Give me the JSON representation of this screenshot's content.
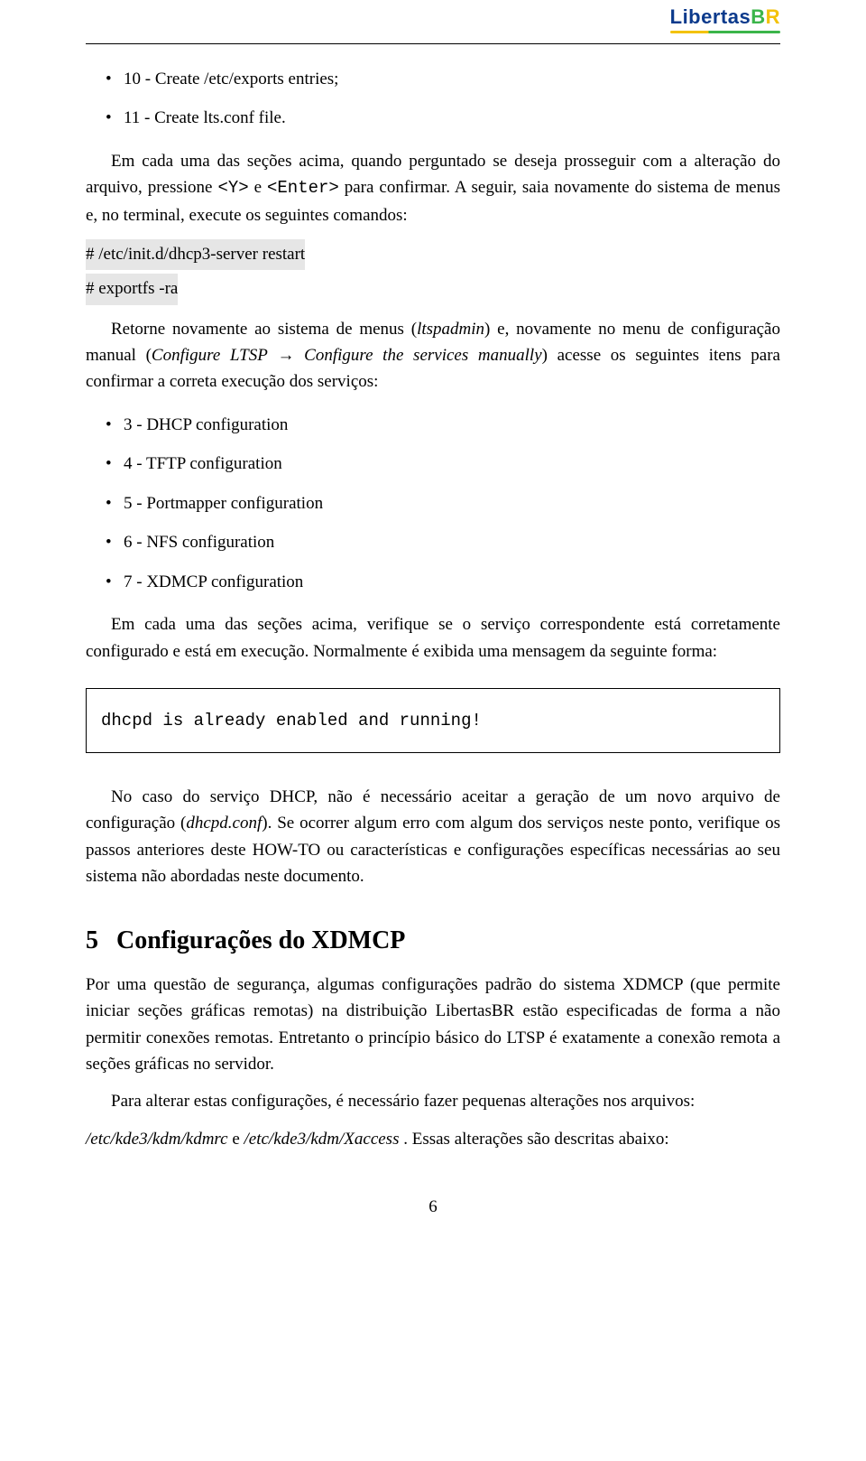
{
  "logo": {
    "text_part1": "Libertas",
    "text_part2": "B",
    "text_part3": "R"
  },
  "list1": {
    "i0": "10 - Create /etc/exports entries;",
    "i1": "11 - Create lts.conf file."
  },
  "p1_a": "Em cada uma das seções acima, quando perguntado se deseja prosseguir com a alteração do arquivo, pressione ",
  "p1_y": "<Y>",
  "p1_b": " e ",
  "p1_enter": "<Enter>",
  "p1_c": " para confirmar. A seguir, saia novamente do sistema de menus e, no terminal, execute os seguintes comandos:",
  "cmd1": "# /etc/init.d/dhcp3-server restart",
  "cmd2": "# exportfs -ra",
  "p2_a": "Retorne novamente ao sistema de menus (",
  "p2_lts": "ltspadmin",
  "p2_b": ") e, novamente no menu de configuração manual (",
  "p2_conf1": "Configure LTSP",
  "p2_arrow": " → ",
  "p2_conf2": "Configure the services manually",
  "p2_c": ") acesse os seguintes itens para confirmar a correta execução dos serviços:",
  "list2": {
    "i0": "3 - DHCP configuration",
    "i1": "4 - TFTP configuration",
    "i2": "5 - Portmapper configuration",
    "i3": "6 - NFS configuration",
    "i4": "7 - XDMCP configuration"
  },
  "p3": "Em cada uma das seções acima, verifique se o serviço correspondente está corretamente configurado e está em execução. Normalmente é exibida uma mensagem da seguinte forma:",
  "codebox": "dhcpd is already enabled and running!",
  "p4_a": "No caso do serviço DHCP, não é necessário aceitar a geração de um novo arquivo de configuração (",
  "p4_conf": "dhcpd.conf",
  "p4_b": "). Se ocorrer algum erro com algum dos serviços neste ponto, verifique os passos anteriores deste HOW-TO ou características e configurações específicas necessárias ao seu sistema não abordadas neste documento.",
  "section": {
    "num": "5",
    "title": "Configurações do XDMCP"
  },
  "p5": "Por uma questão de segurança, algumas configurações padrão do sistema XDMCP (que permite iniciar seções gráficas remotas) na distribuição LibertasBR estão especificadas de forma a não permitir conexões remotas. Entretanto o princípio básico do LTSP é exatamente a conexão remota a seções gráficas no servidor.",
  "p6": "Para alterar estas configurações, é necessário fazer pequenas alterações nos arquivos:",
  "p7_a": "/etc/kde3/kdm/kdmrc",
  "p7_b": " e  ",
  "p7_c": "/etc/kde3/kdm/Xaccess",
  "p7_d": " . Essas alterações são descritas abaixo:",
  "pagenum": "6"
}
